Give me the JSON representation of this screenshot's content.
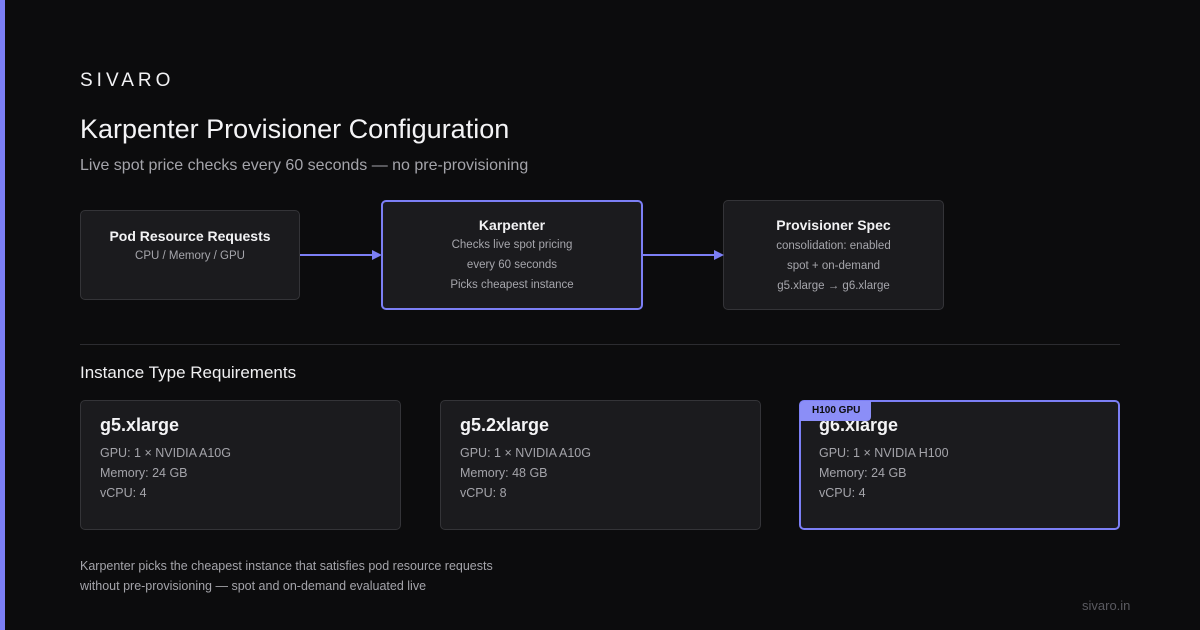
{
  "brand": "SIVARO",
  "title": "Karpenter Provisioner Configuration",
  "subtitle": "Live spot price checks every 60 seconds — no pre-provisioning",
  "flow": {
    "pod_requests": {
      "title": "Pod Resource Requests",
      "lines": [
        "CPU / Memory / GPU"
      ]
    },
    "karpenter": {
      "title": "Karpenter",
      "lines": [
        "Checks live spot pricing",
        "every 60 seconds",
        "Picks cheapest instance"
      ]
    },
    "provisioner_spec": {
      "title": "Provisioner Spec",
      "lines": [
        "consolidation: enabled",
        "spot + on-demand",
        "g5.xlarge → g6.xlarge"
      ]
    }
  },
  "section_title": "Instance Type Requirements",
  "instances": [
    {
      "name": "g5.xlarge",
      "gpu": "GPU: 1 × NVIDIA A10G",
      "memory": "Memory: 24 GB",
      "vcpu": "vCPU: 4",
      "badge": ""
    },
    {
      "name": "g5.2xlarge",
      "gpu": "GPU: 1 × NVIDIA A10G",
      "memory": "Memory: 48 GB",
      "vcpu": "vCPU: 8",
      "badge": ""
    },
    {
      "name": "g6.xlarge",
      "gpu": "GPU: 1 × NVIDIA H100",
      "memory": "Memory: 24 GB",
      "vcpu": "vCPU: 4",
      "badge": "H100 GPU"
    }
  ],
  "footnote": [
    "Karpenter picks the cheapest instance that satisfies pod resource requests",
    "without pre-provisioning — spot and on-demand evaluated live"
  ],
  "site": "sivaro.in",
  "colors": {
    "accent": "#7c7ff5",
    "background": "#0c0c0d",
    "card": "#1b1b1e"
  }
}
